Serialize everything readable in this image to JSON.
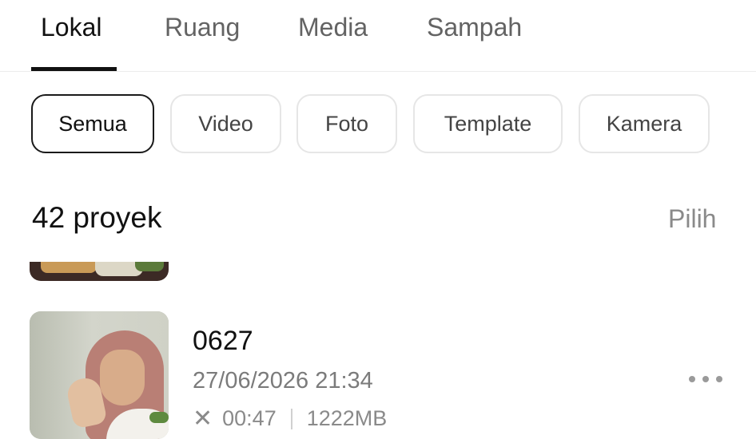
{
  "tabs": [
    {
      "label": "Lokal",
      "active": true
    },
    {
      "label": "Ruang",
      "active": false
    },
    {
      "label": "Media",
      "active": false
    },
    {
      "label": "Sampah",
      "active": false
    }
  ],
  "filters": [
    {
      "label": "Semua",
      "active": true
    },
    {
      "label": "Video",
      "active": false
    },
    {
      "label": "Foto",
      "active": false
    },
    {
      "label": "Template",
      "active": false
    },
    {
      "label": "Kamera",
      "active": false
    }
  ],
  "summary": {
    "count_label": "42 proyek",
    "select_label": "Pilih"
  },
  "projects": [
    {
      "name": "0627",
      "date": "27/06/2026 21:34",
      "duration": "00:47",
      "size": "1222MB",
      "icon": "scissors-icon"
    }
  ],
  "colors": {
    "active_text": "#111111",
    "inactive_text": "#636363",
    "muted_text": "#8a8a8a",
    "chip_border": "#e6e6e6",
    "chip_border_active": "#1a1a1a"
  }
}
